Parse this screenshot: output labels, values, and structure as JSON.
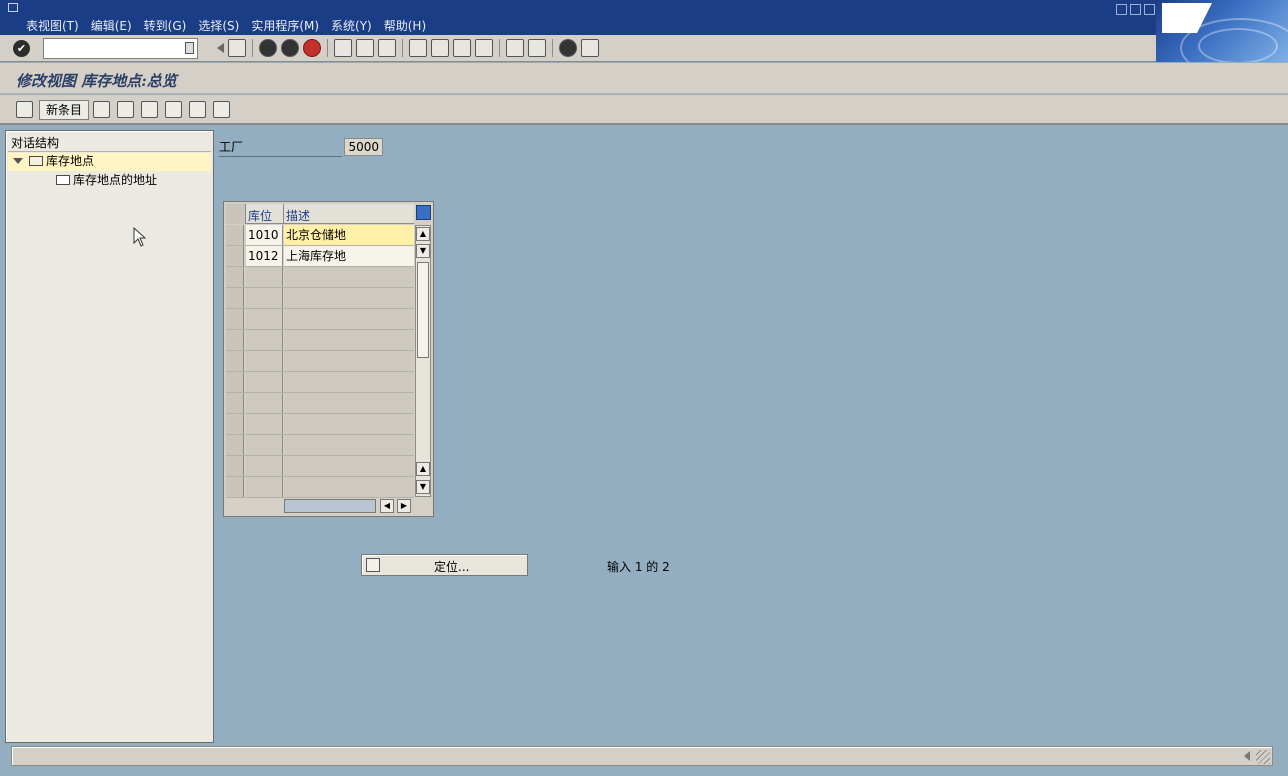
{
  "menu": [
    "表视图(T)",
    "编辑(E)",
    "转到(G)",
    "选择(S)",
    "实用程序(M)",
    "系统(Y)",
    "帮助(H)"
  ],
  "screen_title": "修改视图 库存地点:总览",
  "app_toolbar": {
    "new_entries": "新条目"
  },
  "dialog_structure": {
    "header": "对话结构",
    "node_selected": "库存地点",
    "node_child": "库存地点的地址"
  },
  "plant": {
    "label": "工厂",
    "value": "5000"
  },
  "table": {
    "col_storage": "库位",
    "col_description": "描述",
    "rows": [
      {
        "code": "1010",
        "description": "北京仓储地"
      },
      {
        "code": "1012",
        "description": "上海库存地"
      }
    ]
  },
  "position_button": "定位...",
  "entry_count": "输入 1 的 2",
  "colors": {
    "background": "#93aec1",
    "titlebar": "#1b3d86",
    "selected_row": "#fff0a8",
    "header_text": "#1e3e8a"
  }
}
